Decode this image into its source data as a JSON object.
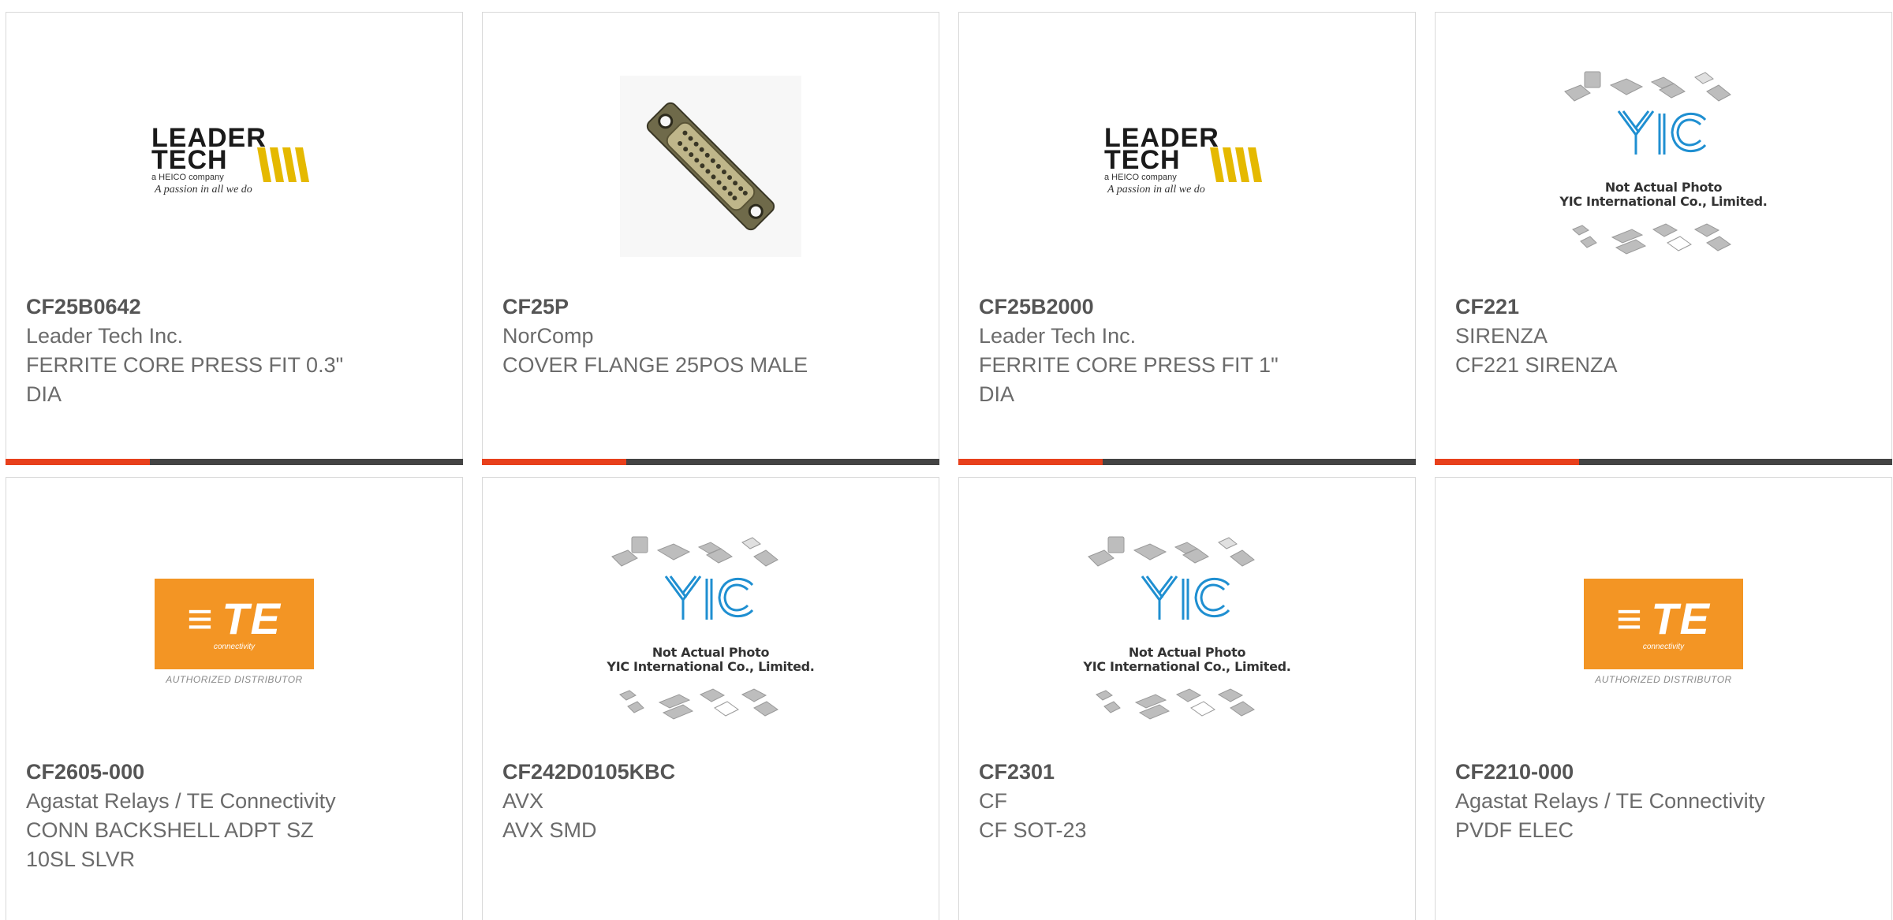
{
  "products": [
    {
      "part_no": "CF25B0642",
      "manufacturer": "Leader Tech Inc.",
      "description": "FERRITE CORE PRESS FIT 0.3\"\nDIA",
      "image": "leader-tech-logo"
    },
    {
      "part_no": "CF25P",
      "manufacturer": "NorComp",
      "description": "COVER FLANGE 25POS MALE",
      "image": "d-sub-connector-photo"
    },
    {
      "part_no": "CF25B2000",
      "manufacturer": "Leader Tech Inc.",
      "description": "FERRITE CORE PRESS FIT 1\"\nDIA",
      "image": "leader-tech-logo"
    },
    {
      "part_no": "CF221",
      "manufacturer": "SIRENZA",
      "description": "CF221 SIRENZA",
      "image": "yic-placeholder"
    },
    {
      "part_no": "CF2605-000",
      "manufacturer": "Agastat Relays / TE Connectivity",
      "description": "CONN BACKSHELL ADPT SZ\n10SL SLVR",
      "image": "te-logo"
    },
    {
      "part_no": "CF242D0105KBC",
      "manufacturer": "AVX",
      "description": "AVX SMD",
      "image": "yic-placeholder"
    },
    {
      "part_no": "CF2301",
      "manufacturer": "CF",
      "description": "CF SOT-23",
      "image": "yic-placeholder"
    },
    {
      "part_no": "CF2210-000",
      "manufacturer": "Agastat Relays / TE Connectivity",
      "description": "PVDF ELEC",
      "image": "te-logo"
    }
  ],
  "logos": {
    "leader_tech": {
      "line1": "LEADER",
      "line2": "TECH",
      "heico": "a HEICO company",
      "tagline": "A passion in all we do"
    },
    "te": {
      "mark": "TE",
      "sub": "connectivity",
      "authorized": "AUTHORIZED DISTRIBUTOR"
    },
    "yic": {
      "mark": "YIC",
      "line1": "Not Actual Photo",
      "line2": "YIC International Co., Limited."
    }
  },
  "colors": {
    "accent": "#e8401c",
    "bar": "#444444",
    "te_orange": "#f39524",
    "yic_blue": "#1f8fd1",
    "text": "#6b6b6b"
  }
}
